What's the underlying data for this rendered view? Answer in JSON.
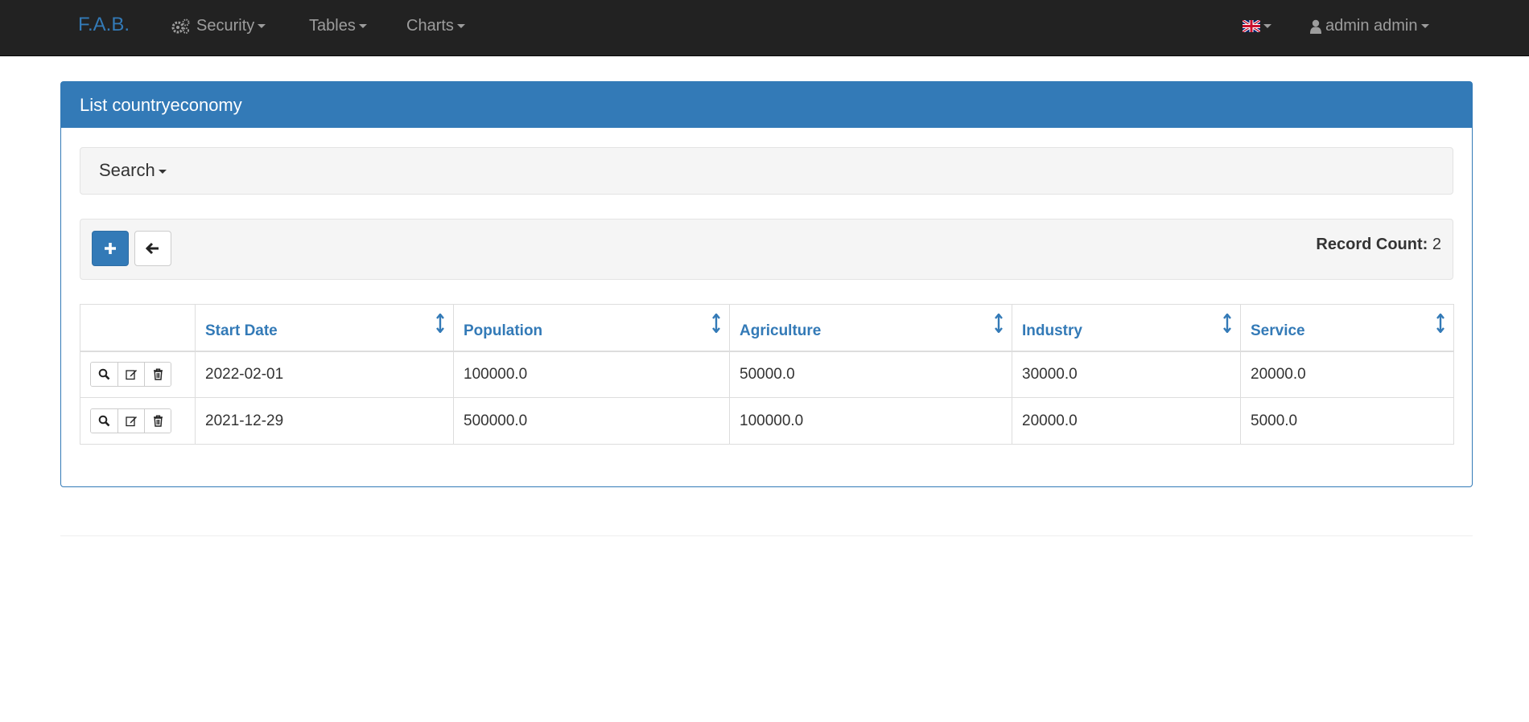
{
  "navbar": {
    "brand": "F.A.B.",
    "menus": [
      {
        "label": "Security",
        "icon": "gears-icon"
      },
      {
        "label": "Tables"
      },
      {
        "label": "Charts"
      }
    ],
    "language_icon": "uk-flag-icon",
    "user": {
      "label": "admin admin",
      "icon": "user-icon"
    }
  },
  "panel": {
    "title": "List countryeconomy",
    "search_label": "Search",
    "add_icon": "plus-icon",
    "back_icon": "arrow-left-icon",
    "record_count_label": "Record Count:",
    "record_count_value": "2"
  },
  "table": {
    "columns": [
      "Start Date",
      "Population",
      "Agriculture",
      "Industry",
      "Service"
    ],
    "rows": [
      [
        "2022-02-01",
        "100000.0",
        "50000.0",
        "30000.0",
        "20000.0"
      ],
      [
        "2021-12-29",
        "500000.0",
        "100000.0",
        "20000.0",
        "5000.0"
      ]
    ],
    "row_action_icons": [
      "search-icon",
      "edit-icon",
      "trash-icon"
    ]
  },
  "colors": {
    "navbar_bg": "#222222",
    "primary": "#337ab7",
    "well_bg": "#f5f5f5"
  }
}
